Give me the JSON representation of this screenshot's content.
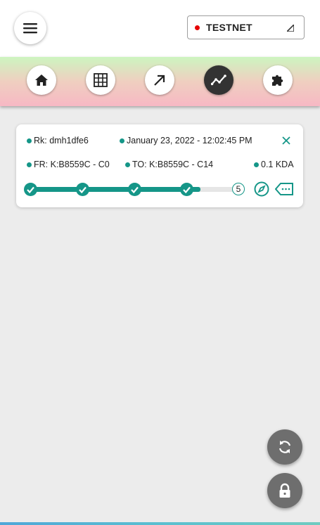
{
  "header": {
    "menu_icon": "hamburger-menu-icon",
    "network": {
      "label": "TESTNET",
      "status_color": "#e60000",
      "dropdown_icon": "corner-triangle-icon"
    }
  },
  "nav": {
    "items": [
      {
        "name": "home",
        "icon": "home-icon",
        "active": false
      },
      {
        "name": "grid",
        "icon": "grid-icon",
        "active": false
      },
      {
        "name": "send",
        "icon": "arrow-up-right-icon",
        "active": false
      },
      {
        "name": "activity",
        "icon": "trend-line-icon",
        "active": true
      },
      {
        "name": "extensions",
        "icon": "puzzle-icon",
        "active": false
      }
    ]
  },
  "transaction": {
    "request_key": "Rk: dmh1dfe6",
    "timestamp": "January 23, 2022 - 12:02:45 PM",
    "from": "FR: K:B8559C - C0",
    "to": "TO: K:B8559C - C14",
    "amount": "0.1 KDA",
    "steps_completed": 4,
    "steps_total": 5,
    "pending_step_label": "5",
    "progress_percent": 80
  },
  "fabs": [
    {
      "name": "refresh",
      "icon": "sync-icon"
    },
    {
      "name": "lock",
      "icon": "lock-icon"
    }
  ],
  "colors": {
    "accent": "#159688",
    "active_nav": "#333333",
    "fab": "#6e6e6e",
    "nav_gradient_top": "#cdf5c0",
    "nav_gradient_bottom": "#f7b8c4"
  }
}
